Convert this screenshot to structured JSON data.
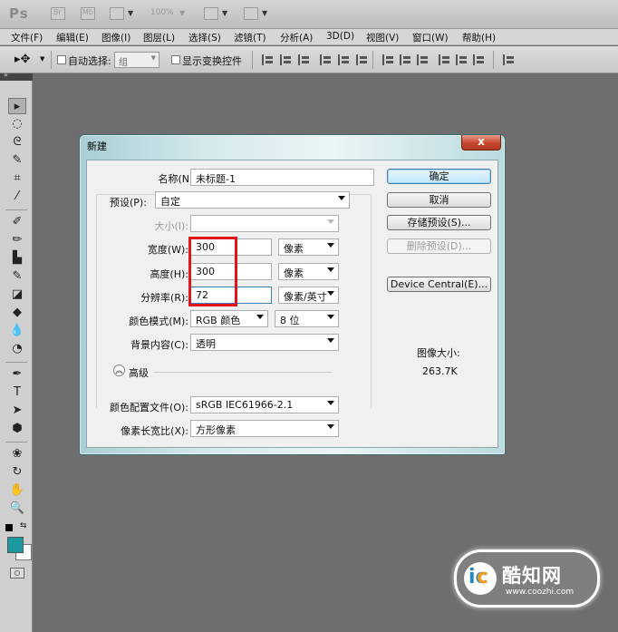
{
  "appbar": {
    "logo": "Ps",
    "br_label": "Br",
    "mb_label": "Mb",
    "zoom": "100%"
  },
  "menu": {
    "items": [
      "文件(F)",
      "编辑(E)",
      "图像(I)",
      "图层(L)",
      "选择(S)",
      "滤镜(T)",
      "分析(A)",
      "3D(D)",
      "视图(V)",
      "窗口(W)",
      "帮助(H)"
    ]
  },
  "options": {
    "auto_select_label": "自动选择:",
    "auto_select_value": "组",
    "show_transform_label": "显示变换控件"
  },
  "dialog": {
    "title": "新建",
    "close_label": "x",
    "name_label": "名称(N):",
    "name_value": "未标题-1",
    "preset_label": "预设(P):",
    "preset_value": "自定",
    "size_label": "大小(I):",
    "width_label": "宽度(W):",
    "width_value": "300",
    "width_unit": "像素",
    "height_label": "高度(H):",
    "height_value": "300",
    "height_unit": "像素",
    "resolution_label": "分辨率(R):",
    "resolution_value": "72",
    "resolution_unit": "像素/英寸",
    "color_mode_label": "颜色模式(M):",
    "color_mode_value": "RGB 颜色",
    "bit_depth_value": "8 位",
    "background_label": "背景内容(C):",
    "background_value": "透明",
    "advanced_label": "高级",
    "advanced_icon": "chevron-double-up-icon",
    "color_profile_label": "颜色配置文件(O):",
    "color_profile_value": "sRGB IEC61966-2.1",
    "pixel_aspect_label": "像素长宽比(X):",
    "pixel_aspect_value": "方形像素",
    "ok_label": "确定",
    "cancel_label": "取消",
    "save_preset_label": "存储预设(S)...",
    "delete_preset_label": "删除预设(D)...",
    "device_central_label": "Device Central(E)...",
    "image_size_label": "图像大小:",
    "image_size_value": "263.7K"
  },
  "watermark": {
    "brand": "酷知网",
    "url": "www.coozhi.com"
  },
  "colors": {
    "foreground": "#1a9a9e",
    "background": "#ffffff",
    "highlight": "#e0161b"
  }
}
